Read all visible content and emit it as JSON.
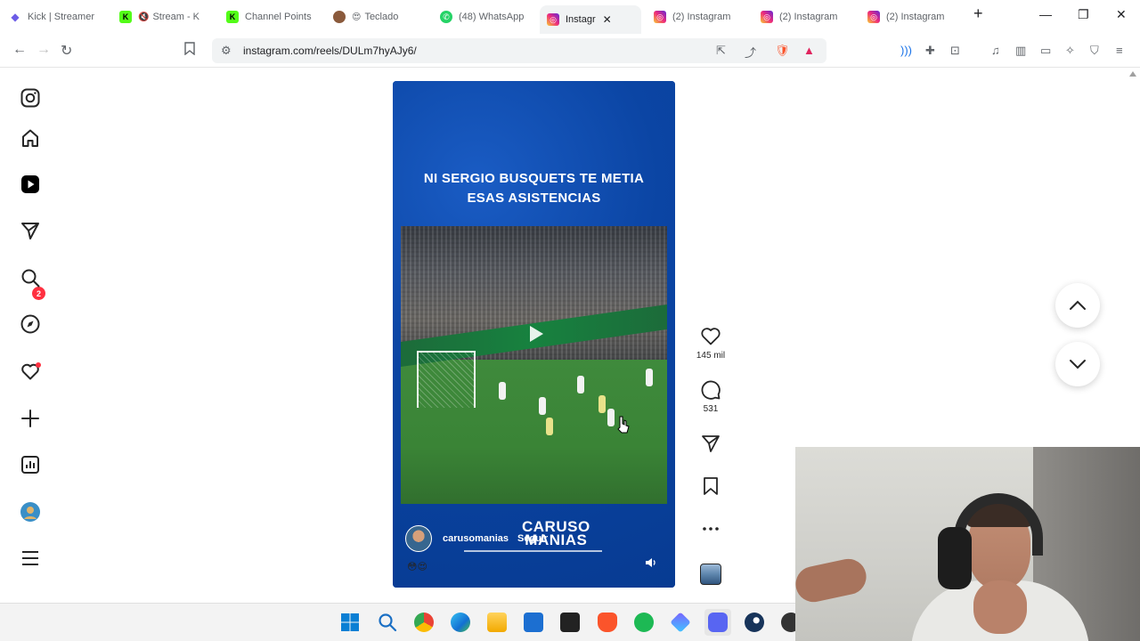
{
  "browser": {
    "tabs": [
      {
        "label": "Kick | Streamer",
        "color": "#6c5ce7",
        "active": false
      },
      {
        "label": "Stream - K",
        "color": "#53fc18",
        "active": false
      },
      {
        "label": "Channel Points",
        "color": "#53fc18",
        "active": false
      },
      {
        "label": "Teclado",
        "color": "#d35400",
        "active": false
      },
      {
        "label": "(48) WhatsApp",
        "color": "#25d366",
        "active": false
      },
      {
        "label": "Instagr",
        "color": "#e1306c",
        "active": true
      },
      {
        "label": "(2) Instagram",
        "color": "#e1306c",
        "active": false
      },
      {
        "label": "(2) Instagram",
        "color": "#e1306c",
        "active": false
      },
      {
        "label": "(2) Instagram",
        "color": "#e1306c",
        "active": false
      }
    ],
    "url": "instagram.com/reels/DULm7hyAJy6/"
  },
  "sidebar": {
    "notification_count": "2",
    "icons": [
      "instagram-logo-icon",
      "home-icon",
      "reels-icon",
      "direct-messages-icon",
      "search-icon",
      "explore-icon",
      "notifications-heart-icon",
      "create-plus-icon",
      "dashboard-icon",
      "profile-avatar",
      "more-menu-icon"
    ]
  },
  "reel": {
    "caption_line1": "NI SERGIO BUSQUETS TE METIA",
    "caption_line2": "ESAS ASISTENCIAS",
    "owner": "carusomanias",
    "follow": "Seguir",
    "brand_line1": "CARUSO",
    "brand_line2": "MANIAS",
    "emojis": "😳😍"
  },
  "actions": {
    "likes": "145 mil",
    "comments": "531"
  },
  "colors": {
    "accent_badge": "#ff3040",
    "reel_background": "#0a47a8"
  }
}
